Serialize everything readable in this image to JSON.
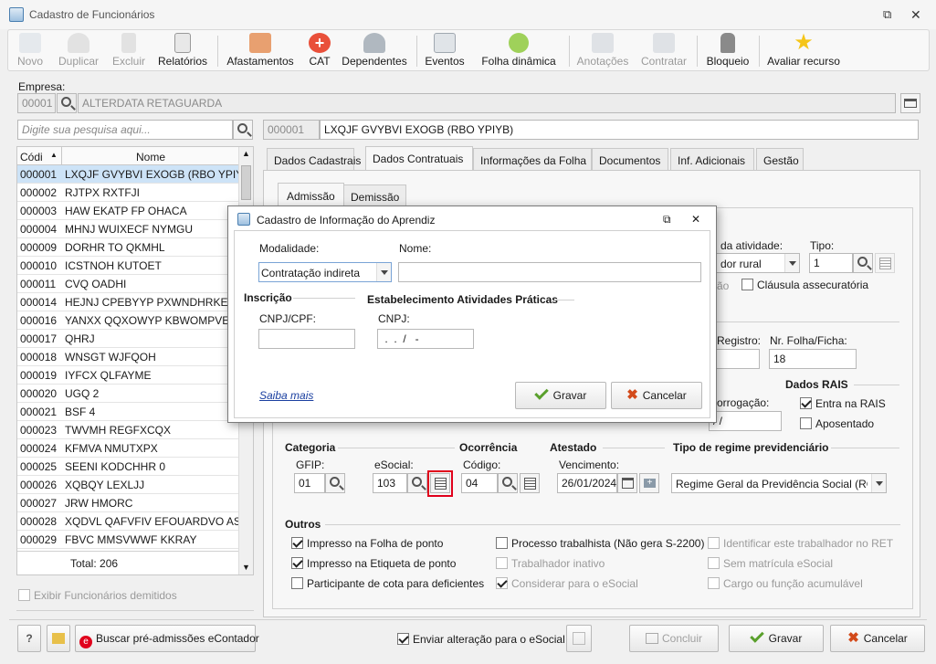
{
  "window": {
    "title": "Cadastro de Funcionários"
  },
  "toolbar": [
    {
      "label": "Novo",
      "enabled": false
    },
    {
      "label": "Duplicar",
      "enabled": false
    },
    {
      "label": "Excluir",
      "enabled": false
    },
    {
      "label": "Relatórios",
      "enabled": true
    },
    {
      "label": "Afastamentos",
      "enabled": true
    },
    {
      "label": "CAT",
      "enabled": true
    },
    {
      "label": "Dependentes",
      "enabled": true
    },
    {
      "label": "Eventos",
      "enabled": true
    },
    {
      "label": "Folha dinâmica",
      "enabled": true
    },
    {
      "label": "Anotações",
      "enabled": false
    },
    {
      "label": "Contratar",
      "enabled": false
    },
    {
      "label": "Bloqueio",
      "enabled": true
    },
    {
      "label": "Avaliar recurso",
      "enabled": true
    }
  ],
  "empresa": {
    "label": "Empresa:",
    "code": "00001",
    "name": "ALTERDATA RETAGUARDA"
  },
  "search": {
    "placeholder": "Digite sua pesquisa aqui..."
  },
  "employee": {
    "code": "000001",
    "name": "LXQJF GVYBVI EXOGB (RBO YPIYB)"
  },
  "grid": {
    "headers": {
      "code": "Códi",
      "name": "Nome"
    },
    "rows": [
      {
        "code": "000001",
        "name": "LXQJF GVYBVI EXOGB (RBO YPIYB)"
      },
      {
        "code": "000002",
        "name": "RJTPX RXTFJI"
      },
      {
        "code": "000003",
        "name": "HAW EKATP FP OHACA"
      },
      {
        "code": "000004",
        "name": "MHNJ WUIXECF NYMGU"
      },
      {
        "code": "000009",
        "name": "DORHR TO QKMHL"
      },
      {
        "code": "000010",
        "name": "ICSTNOH KUTOET"
      },
      {
        "code": "000011",
        "name": "CVQ OADHI"
      },
      {
        "code": "000014",
        "name": "HEJNJ CPEBYYP PXWNDHRKE BTE"
      },
      {
        "code": "000016",
        "name": "YANXX QQXOWYP KBWOMPVEC"
      },
      {
        "code": "000017",
        "name": "QHRJ"
      },
      {
        "code": "000018",
        "name": "WNSGT WJFQOH"
      },
      {
        "code": "000019",
        "name": "IYFCX QLFAYME"
      },
      {
        "code": "000020",
        "name": "UGQ 2"
      },
      {
        "code": "000021",
        "name": "BSF 4"
      },
      {
        "code": "000023",
        "name": "TWVMH REGFXCQX"
      },
      {
        "code": "000024",
        "name": "KFMVA NMUTXPX"
      },
      {
        "code": "000025",
        "name": "SEENI KODCHHR 0"
      },
      {
        "code": "000026",
        "name": "XQBQY LEXLJJ"
      },
      {
        "code": "000027",
        "name": "JRW HMORC"
      },
      {
        "code": "000028",
        "name": "XQDVL QAFVFIV EFOUARDVO AST L"
      },
      {
        "code": "000029",
        "name": "FBVC MMSVWWF KKRAY"
      }
    ],
    "total": "Total: 206"
  },
  "show_dismissed": "Exibir Funcionários demitidos",
  "tabs": [
    "Dados Cadastrais",
    "Dados Contratuais",
    "Informações da Folha",
    "Documentos",
    "Inf. Adicionais",
    "Gestão"
  ],
  "subtabs": [
    "Admissão",
    "Demissão"
  ],
  "partial": {
    "da_atividade": "da atividade:",
    "rural": "dor rural",
    "tipo_label": "Tipo:",
    "tipo_value": "1",
    "ao": "ão",
    "clausula": "Cláusula assecuratória",
    "registro": "Registro:",
    "folha_label": "Nr. Folha/Ficha:",
    "folha_value": "18",
    "rais_title": "Dados RAIS",
    "prorrogacao": "orrogação:",
    "prorrogacao_value": "/ /",
    "entra_rais": "Entra na RAIS",
    "aposentado": "Aposentado"
  },
  "categoria": {
    "title": "Categoria",
    "gfip_label": "GFIP:",
    "gfip_value": "01",
    "esocial_label": "eSocial:",
    "esocial_value": "103"
  },
  "ocorrencia": {
    "title": "Ocorrência",
    "codigo_label": "Código:",
    "codigo_value": "04"
  },
  "atestado": {
    "title": "Atestado",
    "vencimento_label": "Vencimento:",
    "vencimento_value": "26/01/2024"
  },
  "regime": {
    "title": "Tipo de regime previdenciário",
    "value": "Regime Geral da Previdência Social (RGP"
  },
  "outros": {
    "title": "Outros",
    "items": [
      {
        "label": "Impresso na Folha de ponto",
        "checked": true,
        "enabled": true
      },
      {
        "label": "Impresso na Etiqueta de ponto",
        "checked": true,
        "enabled": true
      },
      {
        "label": "Participante de cota para deficientes",
        "checked": false,
        "enabled": true
      },
      {
        "label": "Processo trabalhista (Não gera S-2200)",
        "checked": false,
        "enabled": true
      },
      {
        "label": "Trabalhador inativo",
        "checked": false,
        "enabled": false
      },
      {
        "label": "Considerar para o eSocial",
        "checked": true,
        "enabled": false
      },
      {
        "label": "Identificar este trabalhador no RET",
        "checked": false,
        "enabled": false
      },
      {
        "label": "Sem matrícula eSocial",
        "checked": false,
        "enabled": false
      },
      {
        "label": "Cargo ou função acumulável",
        "checked": false,
        "enabled": false
      }
    ]
  },
  "bottom": {
    "buscar": "Buscar pré-admissões eContador",
    "enviar": "Enviar alteração para o eSocial",
    "concluir": "Concluir",
    "gravar": "Gravar",
    "cancelar": "Cancelar"
  },
  "dialog": {
    "title": "Cadastro de Informação do Aprendiz",
    "modalidade_label": "Modalidade:",
    "modalidade_value": "Contratação indireta",
    "nome_label": "Nome:",
    "nome_value": "",
    "inscricao_title": "Inscrição",
    "cnpj_cpf_label": "CNPJ/CPF:",
    "cnpj_cpf_value": "",
    "estab_title": "Estabelecimento Atividades Práticas",
    "cnpj_label": "CNPJ:",
    "cnpj_value": " .  .  /   -",
    "saiba_mais": "Saiba mais",
    "gravar": "Gravar",
    "cancelar": "Cancelar"
  },
  "colors": {
    "accent_red": "#e0001b",
    "link": "#1a3fa0",
    "selected_row": "#cde3f7",
    "check_green": "#5aa02c",
    "cancel_x": "#d34a1a"
  }
}
